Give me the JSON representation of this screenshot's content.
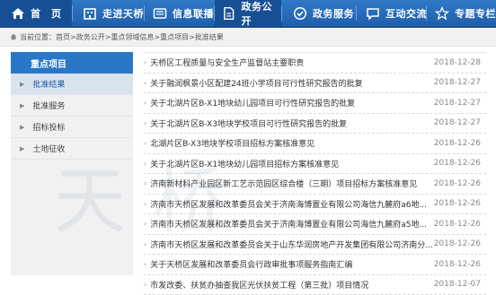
{
  "nav": [
    {
      "label": "首　页",
      "icon": "home-icon"
    },
    {
      "label": "走进天桥",
      "icon": "building-icon"
    },
    {
      "label": "信息联播",
      "icon": "newspaper-icon"
    },
    {
      "label": "政务公开",
      "icon": "document-icon"
    },
    {
      "label": "政务服务",
      "icon": "service-icon"
    },
    {
      "label": "互动交流",
      "icon": "chat-icon"
    },
    {
      "label": "专题专栏",
      "icon": "topic-icon"
    }
  ],
  "breadcrumb": {
    "prefix": "当前位置：",
    "items": [
      "首页",
      "政务公开",
      "重点领域信息",
      "重点项目",
      "批准结果"
    ],
    "sep": ">"
  },
  "sidebar": {
    "title": "重点项目",
    "items": [
      {
        "label": "批准结果",
        "selected": true
      },
      {
        "label": "批准服务",
        "selected": false
      },
      {
        "label": "招标投标",
        "selected": false
      },
      {
        "label": "土地征收",
        "selected": false
      }
    ]
  },
  "list": [
    {
      "title": "天桥区工程质量与安全生产监督站主要职责",
      "date": "2018-12-28"
    },
    {
      "title": "关于融润枫景小区配建24班小学项目可行性研究报告的批复",
      "date": "2018-12-27"
    },
    {
      "title": "关于北湖片区B-X1地块幼儿园项目可行性研究报告的批复",
      "date": "2018-12-27"
    },
    {
      "title": "关于北湖片区B-X3地块学校项目可行性研究报告的批复",
      "date": "2018-12-27"
    },
    {
      "title": "北湖片区B-X3地块学校项目招标方案核准意见",
      "date": "2018-12-26"
    },
    {
      "title": "关于北湖片区B-X1地块幼儿园项目招标方案核准意见",
      "date": "2018-12-26"
    },
    {
      "title": "济南新材料产业园区新工艺示范园区综合楼（三期）项目招标方案核准意见",
      "date": "2018-12-26"
    },
    {
      "title": "济南市天桥区发展和改革委员会关于济南海博置业有限公司海信九麓府a6地...",
      "date": "2018-12-26"
    },
    {
      "title": "济南市天桥区发展和改革委员会关于济南海博置业有限公司海信九麓府a5地...",
      "date": "2018-12-26"
    },
    {
      "title": "济南市天桥区发展和改革委员会关于山东华润房地产开发集团有限公司济南分...",
      "date": "2018-12-26"
    },
    {
      "title": "关于天桥区发展和改革委员会行政审批事项服务指南汇编",
      "date": "2018-12-26"
    },
    {
      "title": "市发改委、扶贫办抽查我区光伏扶贫工程（第三批）项目情况",
      "date": "2018-12-07"
    }
  ],
  "watermark": "天桥"
}
